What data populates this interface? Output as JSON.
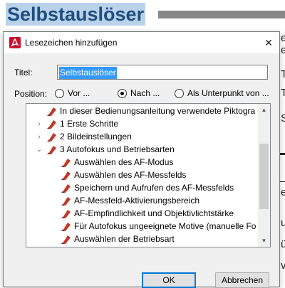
{
  "document": {
    "heading": "Selbstauslöser",
    "right_fragments": [
      "er",
      "er",
      "T",
      "Tc",
      "Se",
      "e",
      "ur",
      "ür",
      "vi"
    ]
  },
  "dialog": {
    "title": "Lesezeichen hinzufügen",
    "close_symbol": "✕",
    "title_label": "Titel:",
    "title_value": "Selbstauslöser",
    "position_label": "Position:",
    "radios": [
      {
        "label": "Vor ...",
        "checked": false
      },
      {
        "label": "Nach ...",
        "checked": true
      },
      {
        "label": "Als Unterpunkt von ...",
        "checked": false
      }
    ],
    "tree": [
      {
        "label": "In dieser Bedienungsanleitung verwendete Piktogra",
        "twisty": ""
      },
      {
        "label": "1 Erste Schritte",
        "twisty": "›"
      },
      {
        "label": "2 Bildeinstellungen",
        "twisty": "›"
      },
      {
        "label": "3 Autofokus und Betriebsarten",
        "twisty": "⌄"
      },
      {
        "label": "Auswählen des AF-Modus",
        "twisty": ""
      },
      {
        "label": "Auswählen des AF-Messfelds",
        "twisty": ""
      },
      {
        "label": "Speichern und Aufrufen des AF-Messfelds",
        "twisty": ""
      },
      {
        "label": "AF-Messfeld-Aktivierungsbereich",
        "twisty": ""
      },
      {
        "label": "AF-Empfindlichkeit und Objektivlichtstärke",
        "twisty": ""
      },
      {
        "label": "Für Autofokus ungeeignete Motive (manuelle Fo",
        "twisty": ""
      },
      {
        "label": "Auswählen der Betriebsart",
        "twisty": ""
      }
    ],
    "ok_label": "OK",
    "cancel_label": "Abbrechen"
  },
  "colors": {
    "heading_text": "#1f4e80",
    "heading_highlight": "#b9d2ea",
    "selection": "#3399ff",
    "bookmark_icon": "#c0392b"
  }
}
